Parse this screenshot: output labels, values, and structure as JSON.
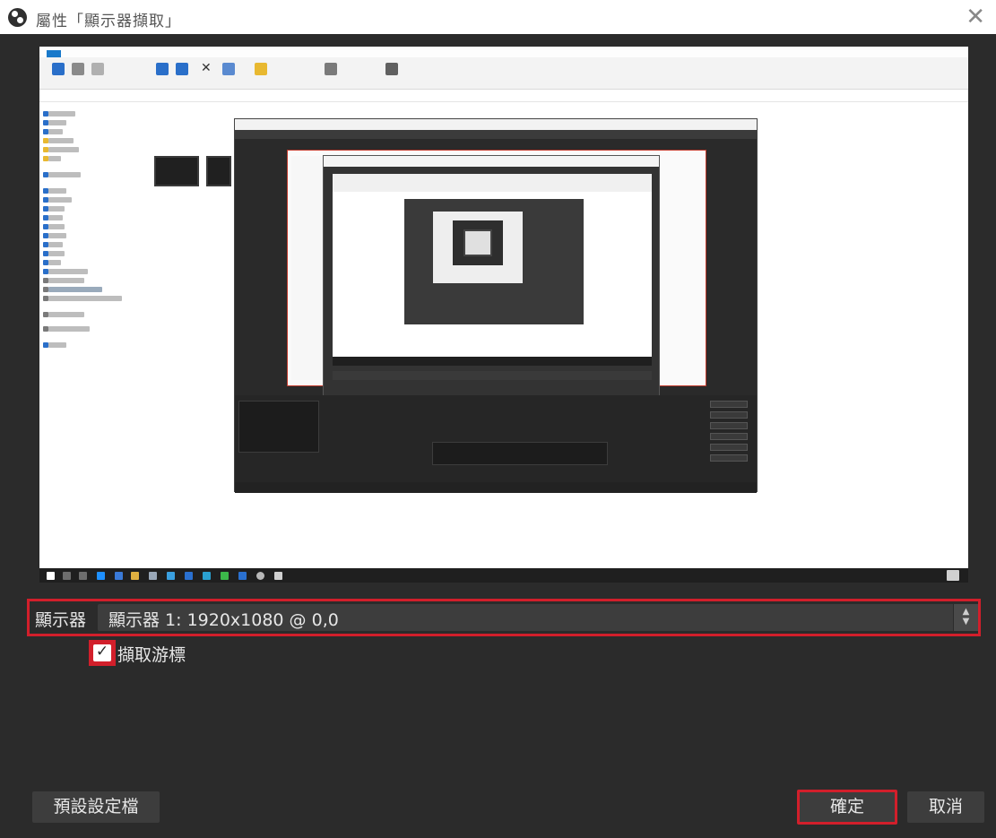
{
  "window": {
    "title": "屬性「顯示器擷取」",
    "close_icon": "close-icon",
    "app_icon": "obs-logo-icon"
  },
  "display": {
    "label": "顯示器",
    "selected": "顯示器 1: 1920x1080 @ 0,0",
    "spinner_icon": "up-down-arrows-icon"
  },
  "capture_cursor": {
    "label": "擷取游標",
    "checked": true
  },
  "buttons": {
    "defaults": "預設設定檔",
    "ok": "確定",
    "cancel": "取消"
  },
  "colors": {
    "highlight": "#d21f2b",
    "dialog_bg": "#2b2b2b",
    "control_bg": "#3d3d3d",
    "text": "#e6e6e6"
  }
}
